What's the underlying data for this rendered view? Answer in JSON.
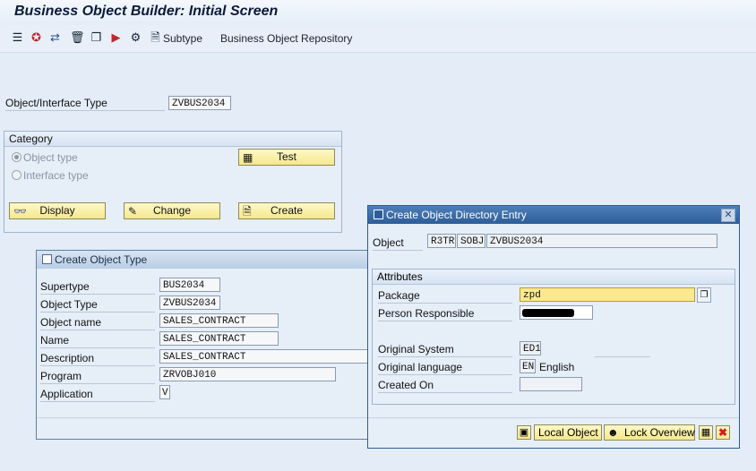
{
  "title": "Business Object Builder: Initial Screen",
  "toolbar": {
    "icons": [
      "hierarchy-icon",
      "activate-icon",
      "where-used-icon",
      "delete-icon",
      "copy-icon",
      "generate-icon",
      "program-icon",
      "subtype-icon"
    ],
    "subtype_label": "Subtype",
    "repository_label": "Business Object Repository"
  },
  "main": {
    "object_type_label": "Object/Interface Type",
    "object_type_value": "ZVBUS2034"
  },
  "category": {
    "header": "Category",
    "radio_object": "Object type",
    "radio_interface": "Interface type",
    "test_label": "Test",
    "display_label": "Display",
    "change_label": "Change",
    "create_label": "Create"
  },
  "create_object_type": {
    "title": "Create Object Type",
    "rows": [
      {
        "label": "Supertype",
        "value": "BUS2034"
      },
      {
        "label": "Object Type",
        "value": "ZVBUS2034"
      },
      {
        "label": "Object name",
        "value": "SALES_CONTRACT"
      },
      {
        "label": "Name",
        "value": "SALES_CONTRACT"
      },
      {
        "label": "Description",
        "value": "SALES_CONTRACT"
      },
      {
        "label": "Program",
        "value": "ZRVOBJ010"
      },
      {
        "label": "Application",
        "value": "V"
      }
    ]
  },
  "create_directory_entry": {
    "title": "Create Object Directory Entry",
    "object_label": "Object",
    "object_parts": [
      "R3TR",
      "SOBJ",
      "ZVBUS2034"
    ],
    "attributes_header": "Attributes",
    "package_label": "Package",
    "package_value": "zpd",
    "person_label": "Person Responsible",
    "original_system_label": "Original System",
    "original_system_value": "ED1",
    "original_language_label": "Original language",
    "original_language_value": "EN",
    "original_language_name": "English",
    "created_on_label": "Created On",
    "local_object_label": "Local Object",
    "lock_overview_label": "Lock Overview"
  }
}
